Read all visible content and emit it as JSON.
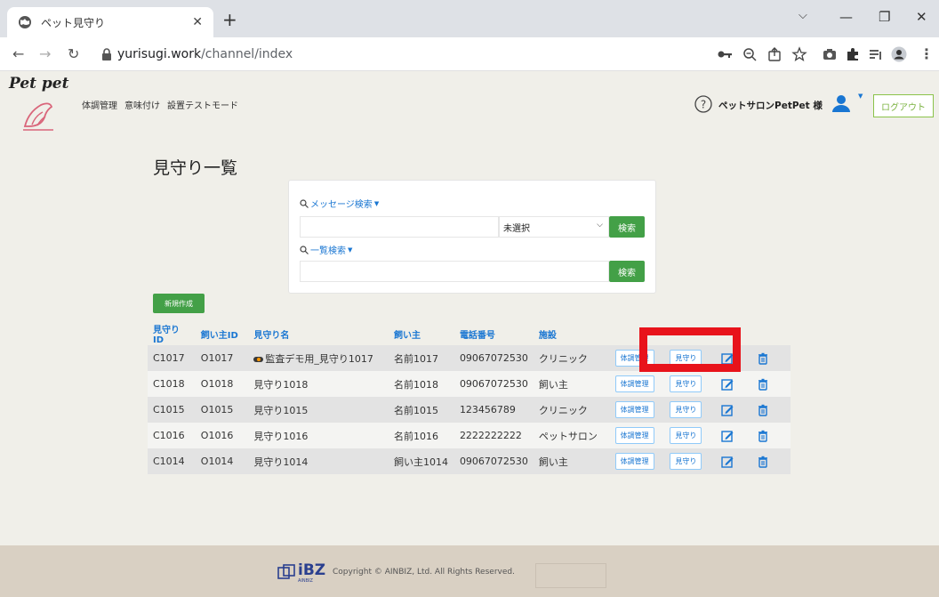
{
  "browser": {
    "tab_title": "ペット見守り",
    "url_host": "yurisugi.work",
    "url_path": "/channel/index",
    "window_controls": {
      "minimize": "—",
      "restore": "❐",
      "close": "✕"
    }
  },
  "header": {
    "logo_text": "Pet pet",
    "nav": [
      "体調管理",
      "意味付け",
      "設置テストモード"
    ],
    "salon_name": "ペットサロンPetPet 様",
    "logout_label": "ログアウト"
  },
  "page": {
    "title": "見守り一覧"
  },
  "search": {
    "message_label": "メッセージ検索",
    "message_value": "",
    "select_value": "未選択",
    "message_button": "検索",
    "list_label": "一覧検索",
    "list_value": "",
    "list_button": "検索"
  },
  "new_button": "新規作成",
  "table": {
    "headers": [
      "見守りID",
      "飼い主ID",
      "見守り名",
      "飼い主",
      "電話番号",
      "施設"
    ],
    "rows": [
      {
        "id": "C1017",
        "owner_id": "O1017",
        "name": "監査デモ用_見守り1017",
        "owner": "名前1017",
        "phone": "09067072530",
        "facility": "クリニック"
      },
      {
        "id": "C1018",
        "owner_id": "O1018",
        "name": "見守り1018",
        "owner": "名前1018",
        "phone": "09067072530",
        "facility": "飼い主"
      },
      {
        "id": "C1015",
        "owner_id": "O1015",
        "name": "見守り1015",
        "owner": "名前1015",
        "phone": "123456789",
        "facility": "クリニック"
      },
      {
        "id": "C1016",
        "owner_id": "O1016",
        "name": "見守り1016",
        "owner": "名前1016",
        "phone": "2222222222",
        "facility": "ペットサロン"
      },
      {
        "id": "C1014",
        "owner_id": "O1014",
        "name": "見守り1014",
        "owner": "飼い主1014",
        "phone": "09067072530",
        "facility": "飼い主"
      }
    ],
    "btn_health": "体調管理",
    "btn_watch": "見守り"
  },
  "footer": {
    "brand": "iBZ",
    "brand_sub": "AINBIZ",
    "copyright": "Copyright © AINBIZ, Ltd. All Rights Reserved."
  },
  "colors": {
    "accent": "#1976d2",
    "search_button": "#43a047",
    "highlight": "#e8131b",
    "footer_bg": "#d9d0c3"
  }
}
